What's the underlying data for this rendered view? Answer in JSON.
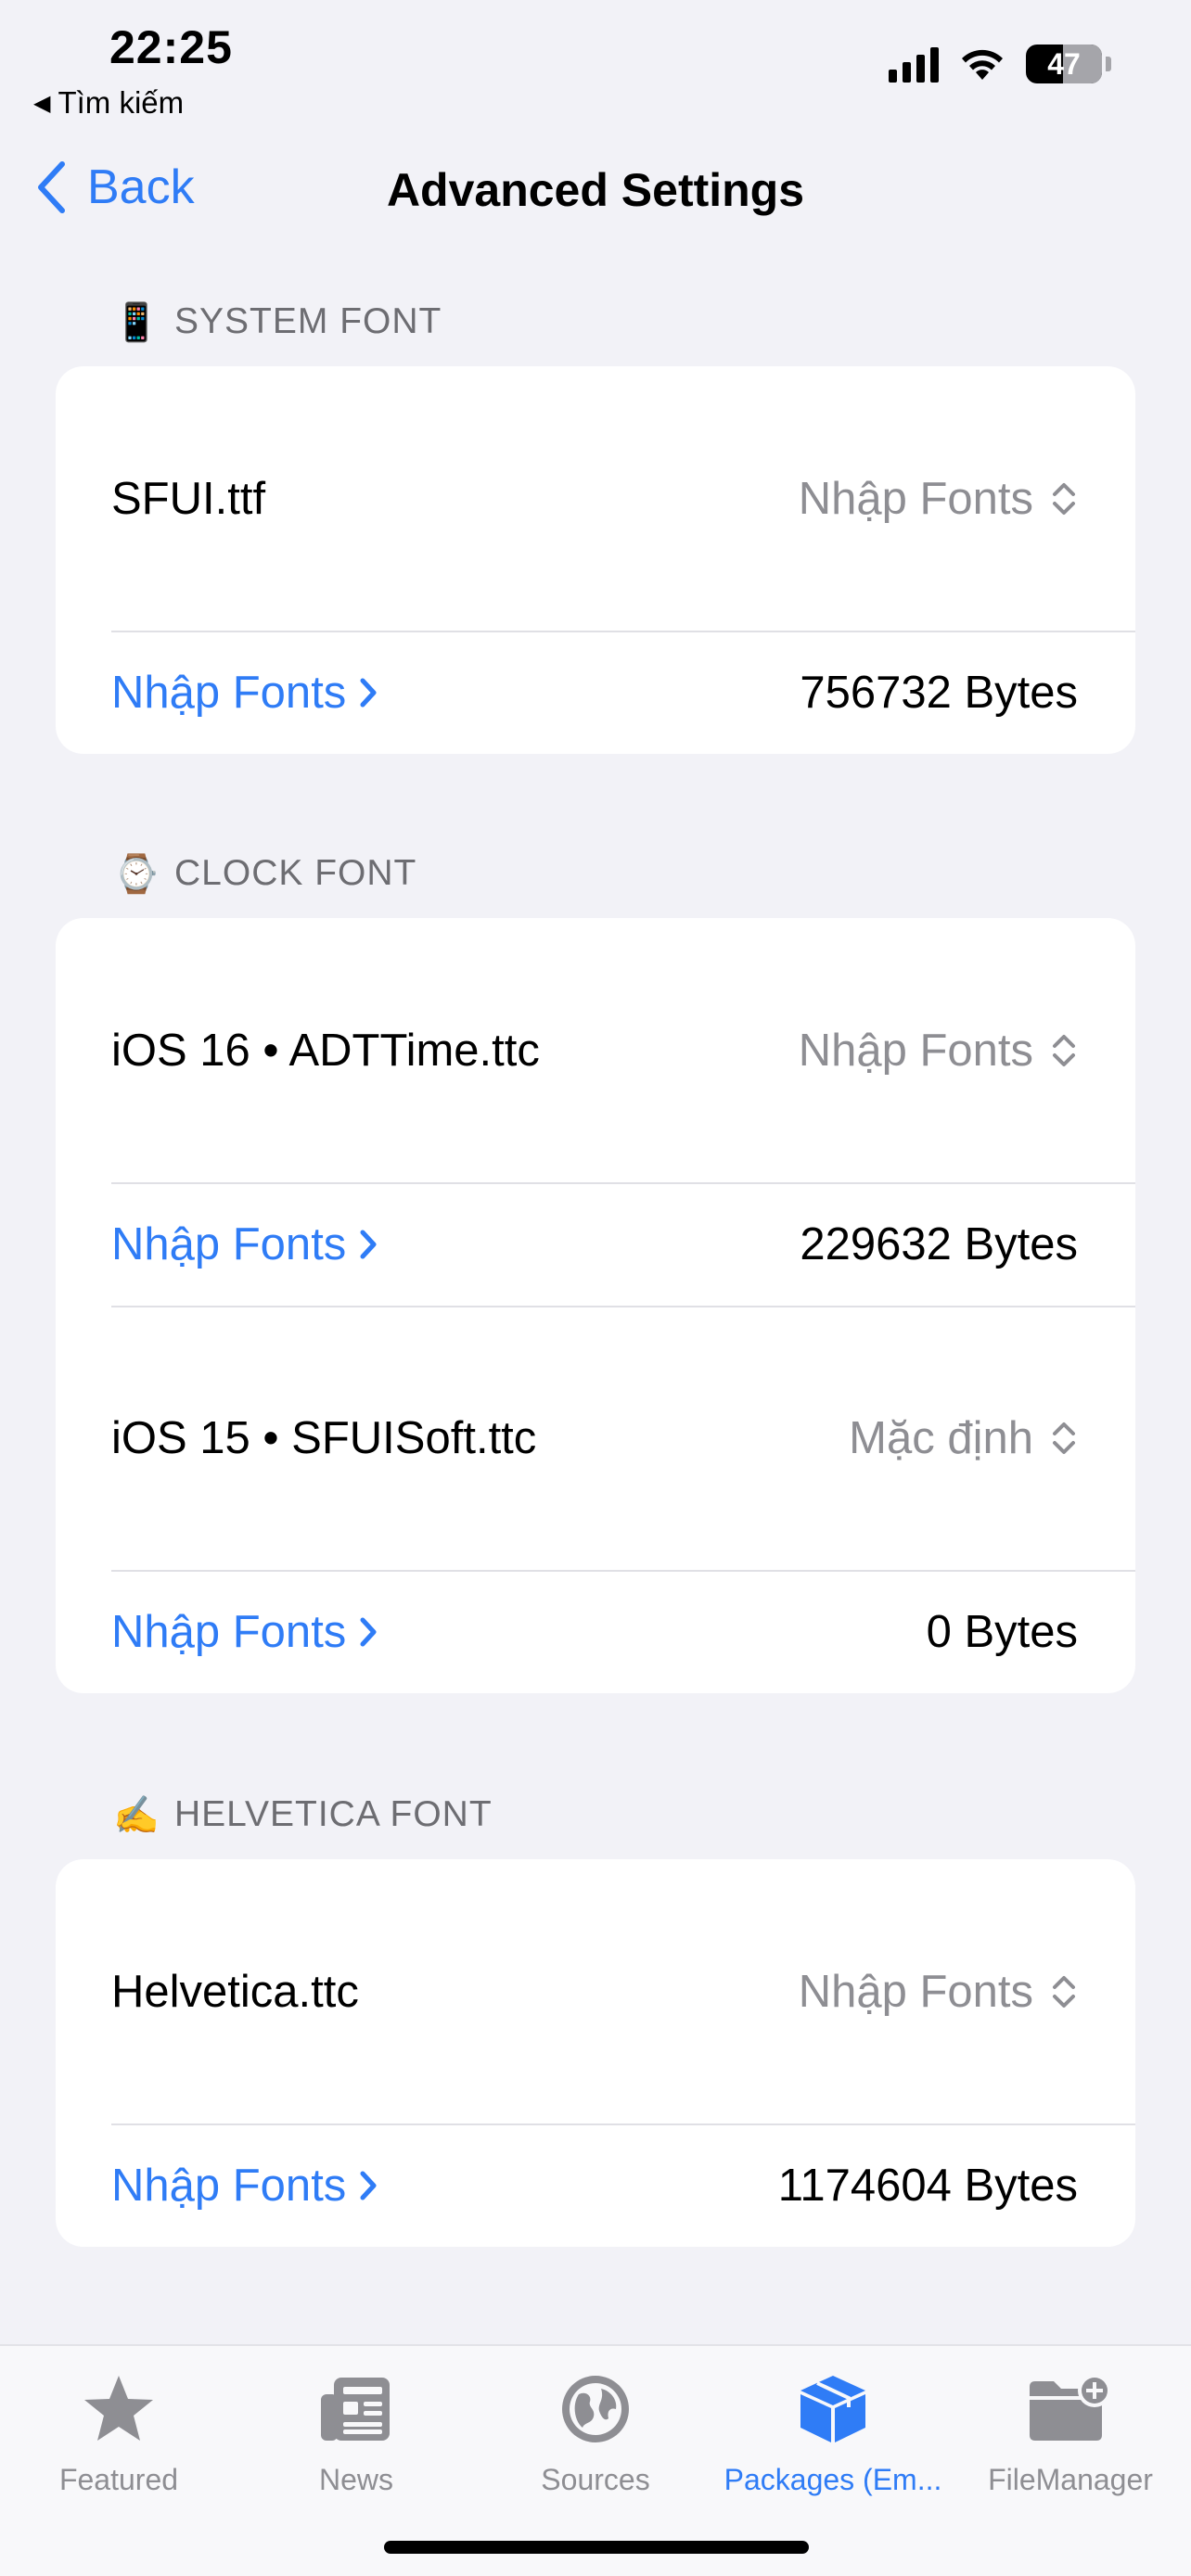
{
  "status_bar": {
    "time": "22:25",
    "back_app": "Tìm kiếm",
    "battery": "47"
  },
  "nav": {
    "back_label": "Back",
    "title": "Advanced Settings"
  },
  "sections": [
    {
      "emoji": "📱",
      "header": "SYSTEM FONT",
      "rows": [
        {
          "title": "SFUI.ttf",
          "picker": "Nhập Fonts",
          "link": "Nhập Fonts",
          "size": "756732 Bytes"
        }
      ]
    },
    {
      "emoji": "⌚",
      "header": "CLOCK FONT",
      "rows": [
        {
          "title": "iOS 16 • ADTTime.ttc",
          "picker": "Nhập Fonts",
          "link": "Nhập Fonts",
          "size": "229632 Bytes"
        },
        {
          "title": "iOS 15 • SFUISoft.ttc",
          "picker": "Mặc định",
          "link": "Nhập Fonts",
          "size": "0 Bytes"
        }
      ]
    },
    {
      "emoji": "✍️",
      "header": "HELVETICA FONT",
      "rows": [
        {
          "title": "Helvetica.ttc",
          "picker": "Nhập Fonts",
          "link": "Nhập Fonts",
          "size": "1174604 Bytes"
        }
      ]
    }
  ],
  "tabs": [
    {
      "label": "Featured",
      "icon": "star-icon",
      "active": false
    },
    {
      "label": "News",
      "icon": "newspaper-icon",
      "active": false
    },
    {
      "label": "Sources",
      "icon": "globe-icon",
      "active": false
    },
    {
      "label": "Packages (Em...",
      "icon": "package-icon",
      "active": true
    },
    {
      "label": "FileManager",
      "icon": "folder-add-icon",
      "active": false
    }
  ],
  "colors": {
    "accent": "#2f7cf6",
    "background": "#f2f2f7",
    "secondary_text": "#8e8e93"
  }
}
